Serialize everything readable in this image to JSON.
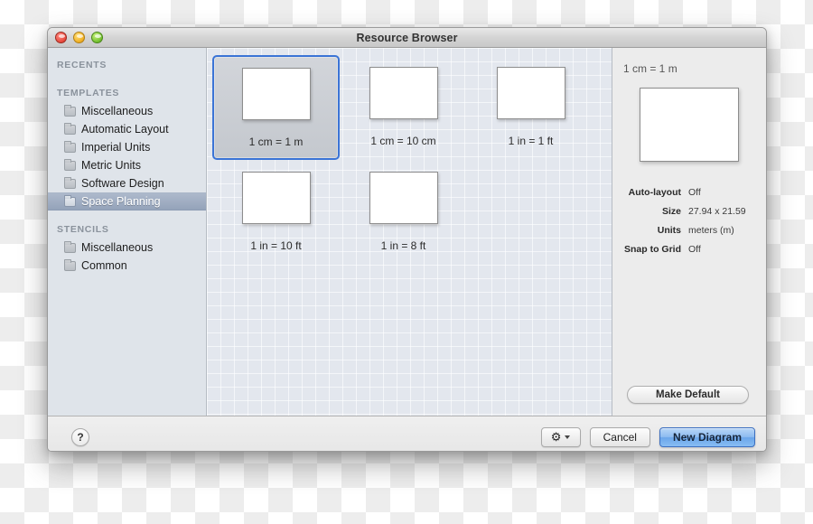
{
  "window": {
    "title": "Resource Browser",
    "traffic_lights": [
      "close-button",
      "minimize-button",
      "zoom-button"
    ]
  },
  "sidebar": {
    "groups": [
      {
        "heading": "RECENTS",
        "items": []
      },
      {
        "heading": "TEMPLATES",
        "items": [
          {
            "label": "Miscellaneous",
            "selected": false
          },
          {
            "label": "Automatic Layout",
            "selected": false
          },
          {
            "label": "Imperial Units",
            "selected": false
          },
          {
            "label": "Metric Units",
            "selected": false
          },
          {
            "label": "Software Design",
            "selected": false
          },
          {
            "label": "Space Planning",
            "selected": true
          }
        ]
      },
      {
        "heading": "STENCILS",
        "items": [
          {
            "label": "Miscellaneous",
            "selected": false
          },
          {
            "label": "Common",
            "selected": false
          }
        ]
      }
    ]
  },
  "templates": [
    {
      "label": "1 cm = 1 m",
      "selected": true
    },
    {
      "label": "1 cm = 10 cm",
      "selected": false
    },
    {
      "label": "1 in = 1 ft",
      "selected": false
    },
    {
      "label": "1 in = 10 ft",
      "selected": false
    },
    {
      "label": "1 in = 8 ft",
      "selected": false
    }
  ],
  "info": {
    "title": "1 cm = 1 m",
    "properties": [
      {
        "label": "Auto-layout",
        "value": "Off"
      },
      {
        "label": "Size",
        "value": "27.94 x 21.59"
      },
      {
        "label": "Units",
        "value": "meters (m)"
      },
      {
        "label": "Snap to Grid",
        "value": "Off"
      }
    ],
    "make_default_label": "Make Default"
  },
  "bottom_bar": {
    "help_label": "?",
    "gear_icon": "gear-icon",
    "cancel_label": "Cancel",
    "new_diagram_label": "New Diagram"
  },
  "colors": {
    "selection_blue": "#3b74d6",
    "default_button_blue": "#6ba6ea",
    "sidebar_bg": "#dfe4ea",
    "grid_bg": "#e3e7ee"
  }
}
